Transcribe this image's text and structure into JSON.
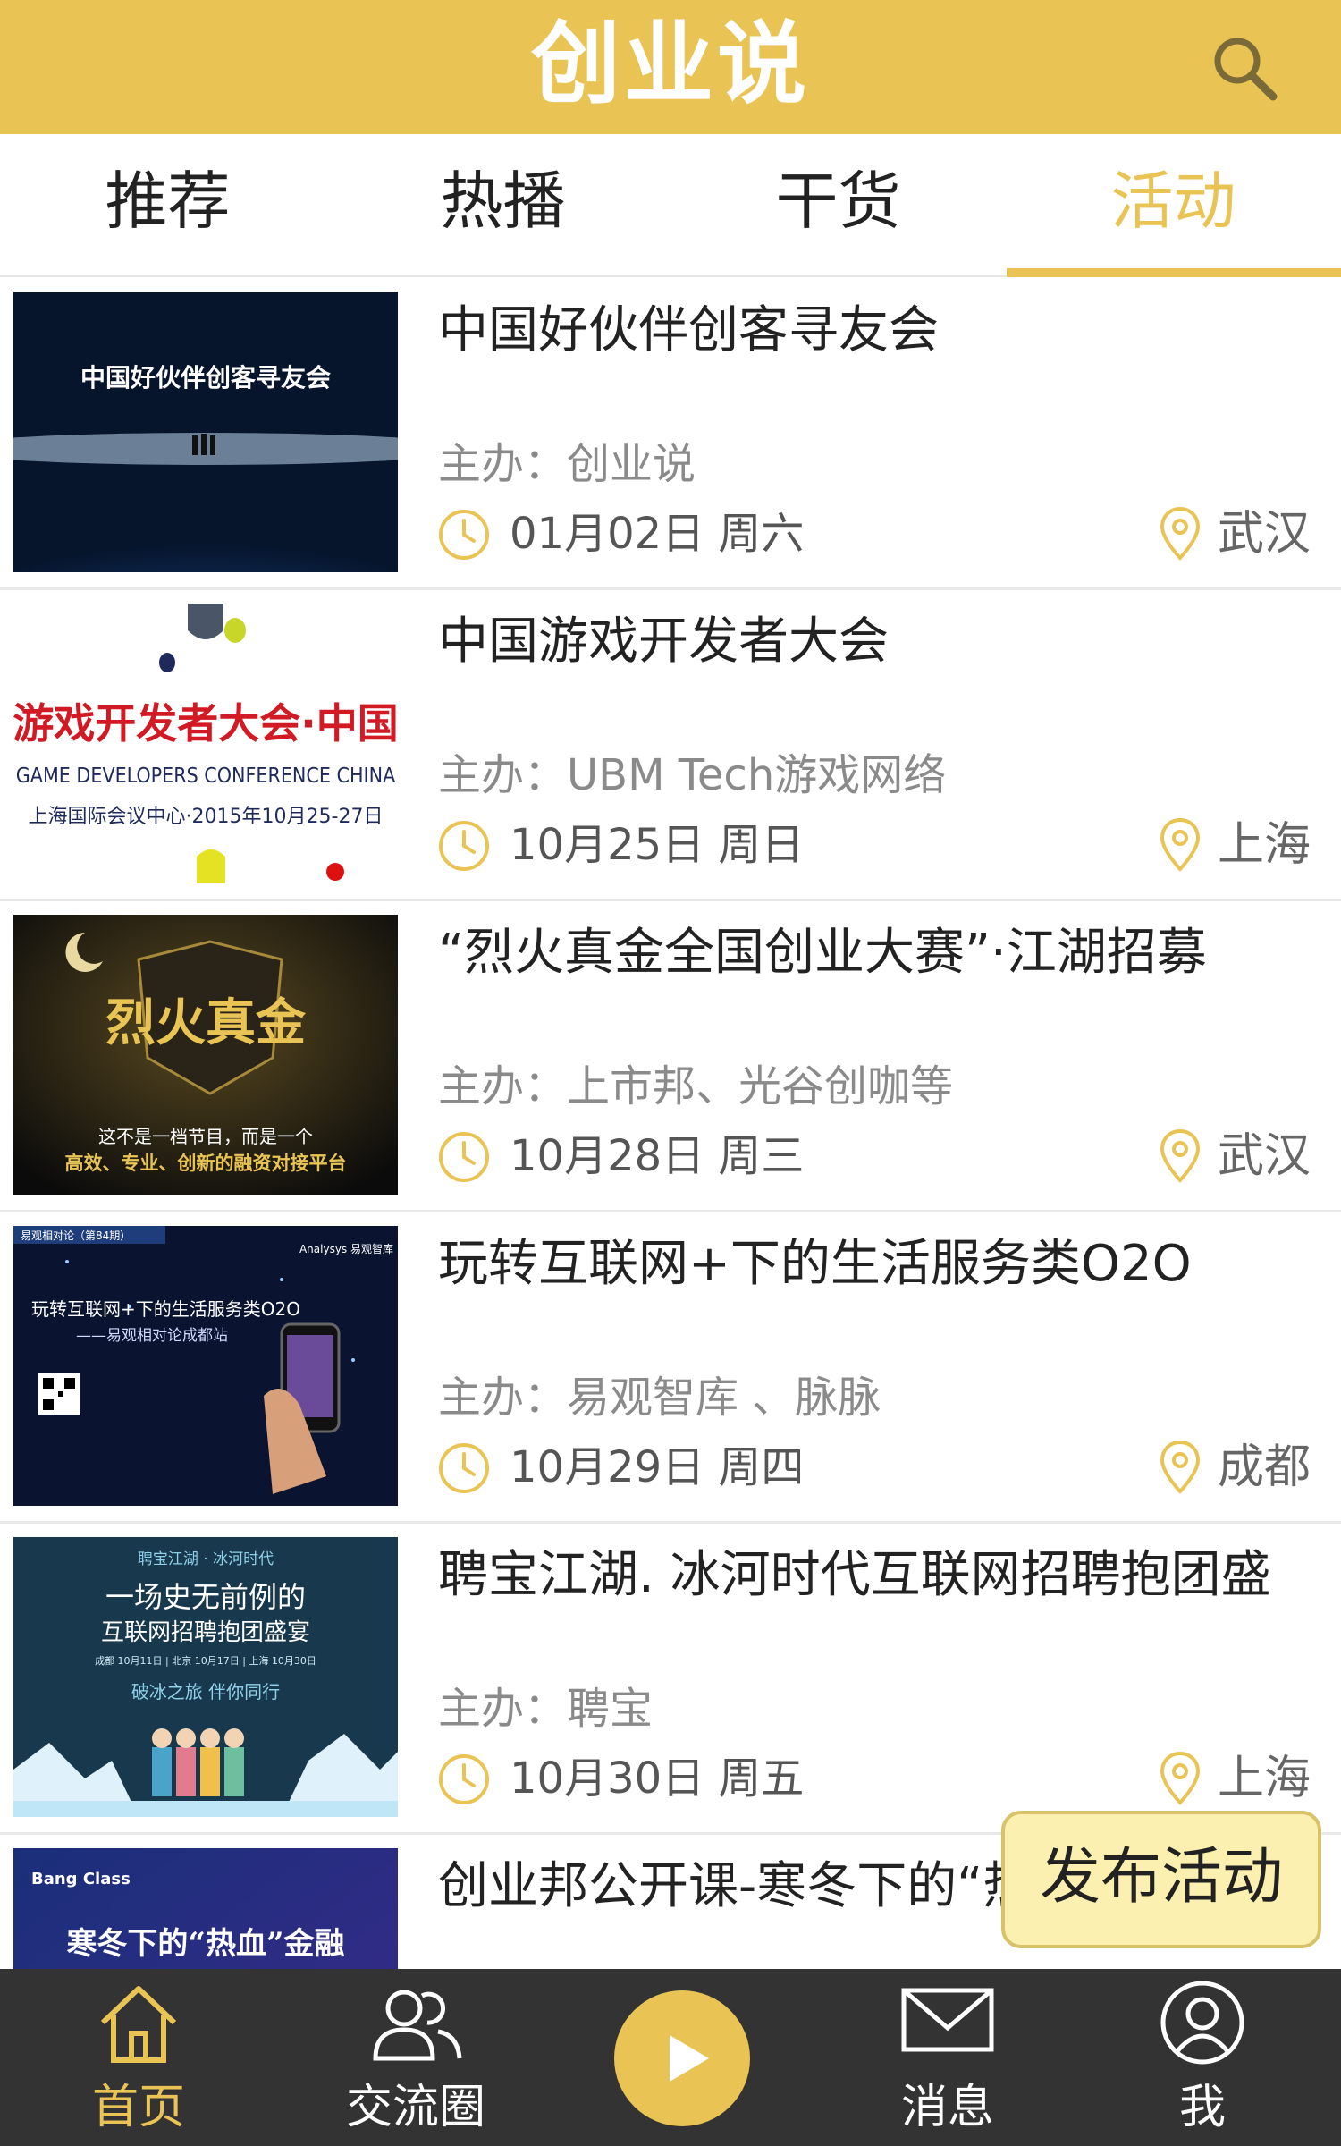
{
  "header": {
    "title": "创业说",
    "search_icon": "search-icon"
  },
  "tabs": [
    {
      "label": "推荐"
    },
    {
      "label": "热播"
    },
    {
      "label": "干货"
    },
    {
      "label": "活动",
      "active": true
    }
  ],
  "events": [
    {
      "title": "中国好伙伴创客寻友会",
      "org": "主办：创业说",
      "date": "01月02日 周六",
      "city": "武汉",
      "image_text": [
        "中国好伙伴创客寻友会"
      ]
    },
    {
      "title": "中国游戏开发者大会",
      "org": "主办：UBM Tech游戏网络",
      "date": "10月25日 周日",
      "city": "上海",
      "image_text": [
        "游戏开发者大会·中国",
        "GAME DEVELOPERS CONFERENCE CHINA",
        "上海国际会议中心·2015年10月25-27日"
      ]
    },
    {
      "title": "“烈火真金全国创业大赛”·江湖招募",
      "org": "主办：上市邦、光谷创咖等",
      "date": "10月28日 周三",
      "city": "武汉",
      "image_text": [
        "烈火真金",
        "这不是一档节目，而是一个",
        "高效、专业、创新的融资对接平台"
      ]
    },
    {
      "title": "玩转互联网+下的生活服务类O2O",
      "org": "主办：易观智库 、脉脉",
      "date": "10月29日 周四",
      "city": "成都",
      "image_text": [
        "易观相对论（第84期）",
        "Analysys 易观智库",
        "玩转互联网+下的生活服务类O2O",
        "——易观相对论成都站"
      ]
    },
    {
      "title": "聘宝江湖. 冰河时代互联网招聘抱团盛",
      "org": "主办：聘宝",
      "date": "10月30日 周五",
      "city": "上海",
      "image_text": [
        "聘宝江湖 · 冰河时代",
        "一场史无前例的",
        "互联网招聘抱团盛宴",
        "成都 10月11日 | 北京 10月17日 | 上海 10月30日",
        "破冰之旅 伴你同行"
      ]
    },
    {
      "title": "创业邦公开课-寒冬下的“热血”金融",
      "org": "",
      "date": "",
      "city": "",
      "image_text": [
        "Bang Class",
        "寒冬下的“热血”金融"
      ]
    }
  ],
  "publish_button": {
    "label": "发布活动"
  },
  "bottom_nav": [
    {
      "label": "首页",
      "icon": "home-icon",
      "active": true
    },
    {
      "label": "交流圈",
      "icon": "people-icon"
    },
    {
      "label": "",
      "icon": "play-icon"
    },
    {
      "label": "消息",
      "icon": "mail-icon"
    },
    {
      "label": "我",
      "icon": "user-icon"
    }
  ],
  "colors": {
    "brand_yellow": "#e9c454",
    "nav_background": "#333333",
    "publish_background": "#fbf0b0"
  }
}
